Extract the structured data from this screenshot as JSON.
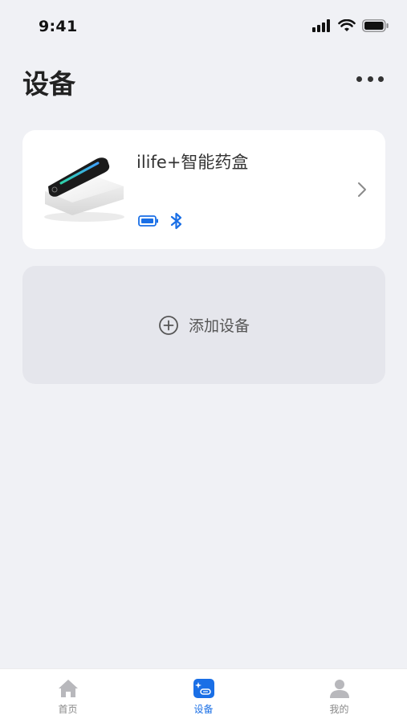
{
  "status_bar": {
    "time": "9:41",
    "icons": [
      "signal-icon",
      "wifi-icon",
      "battery-icon"
    ]
  },
  "header": {
    "title": "设备",
    "more_icon": "more-dots-icon"
  },
  "device_card": {
    "name": "ilife+智能药盒",
    "status_icons": [
      "battery-icon",
      "bluetooth-icon"
    ],
    "accent_color": "#1a6fe6"
  },
  "add_device": {
    "label": "添加设备",
    "icon": "plus-circle-icon"
  },
  "tab_bar": {
    "active_color": "#1a6fe6",
    "tabs": [
      {
        "label": "首页",
        "icon": "home-icon",
        "active": false
      },
      {
        "label": "设备",
        "icon": "device-icon",
        "active": true
      },
      {
        "label": "我的",
        "icon": "user-icon",
        "active": false
      }
    ]
  }
}
